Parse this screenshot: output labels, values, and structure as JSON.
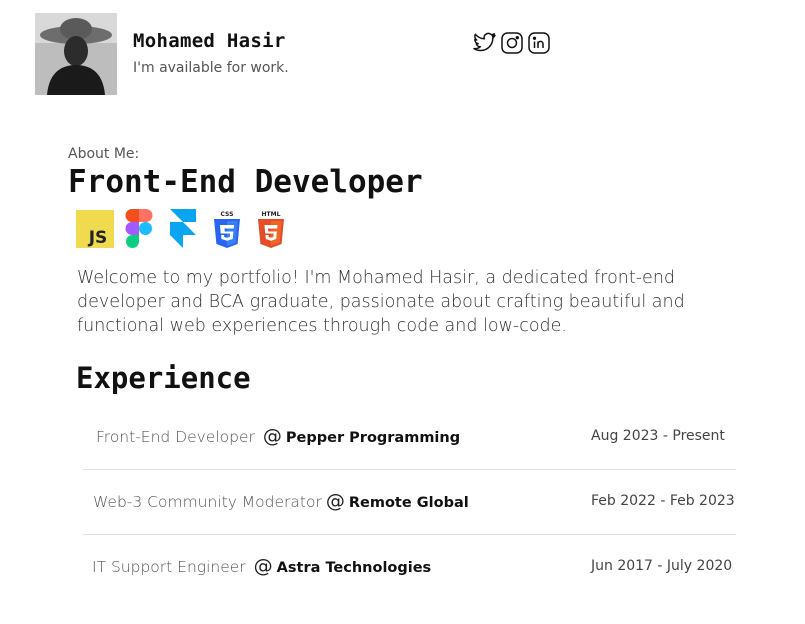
{
  "profile": {
    "name": "Mohamed Hasir",
    "tagline": "I'm available for work."
  },
  "socials": [
    {
      "icon": "twitter-icon"
    },
    {
      "icon": "instagram-icon"
    },
    {
      "icon": "linkedin-icon"
    }
  ],
  "about": {
    "label": "About Me:",
    "headline": "Front-End Developer",
    "bio": "Welcome to my portfolio! I'm Mohamed Hasir, a dedicated front-end developer and BCA graduate, passionate about crafting beautiful and functional web experiences through code and low-code."
  },
  "techs": [
    {
      "icon": "javascript-icon",
      "text": "JS",
      "color": "#f0db4f"
    },
    {
      "icon": "figma-icon"
    },
    {
      "icon": "framer-icon",
      "color": "#0aa5f0"
    },
    {
      "icon": "css3-icon",
      "text": "CSS",
      "color": "#2965f1"
    },
    {
      "icon": "html5-icon",
      "text": "HTML",
      "color": "#e44d26"
    }
  ],
  "experience": {
    "title": "Experience",
    "at": "@",
    "items": [
      {
        "role": "Front-End Developer",
        "company": "Pepper Programming",
        "dates": "Aug 2023 - Present"
      },
      {
        "role": "Web-3 Community Moderator",
        "company": "Remote Global",
        "dates": "Feb 2022 - Feb 2023"
      },
      {
        "role": "IT Support Engineer",
        "company": "Astra Technologies",
        "dates": "Jun 2017 - July 2020"
      }
    ]
  }
}
